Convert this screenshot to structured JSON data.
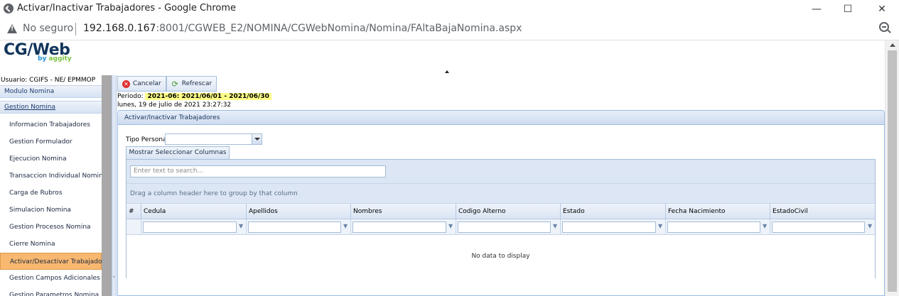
{
  "window": {
    "title": "Activar/Inactivar Trabajadores - Google Chrome",
    "minimize": "—",
    "maximize": "☐",
    "close": "✕"
  },
  "address": {
    "security": "No seguro",
    "url_host": "192.168.0.167",
    "url_path": ":8001/CGWEB_E2/NOMINA/CGWebNomina/Nomina/FAltaBajaNomina.aspx"
  },
  "logo": {
    "text": "CG/Web",
    "by": "by",
    "brand": "aggity"
  },
  "sidebar": {
    "user": "Usuario: CGIFS - NE/ EPMMOP",
    "groups": [
      "Modulo Nomina",
      "Gestion Nomina"
    ],
    "items": [
      "Informacion Trabajadores",
      "Gestion Formulador",
      "Ejecucion Nomina",
      "Transaccion Individual Nomina",
      "Carga de Rubros",
      "Simulacion Nomina",
      "Gestion Procesos Nomina",
      "Cierre Nomina",
      "Activar/Desactivar Trabajadores",
      "Gestion Campos Adicionales",
      "Gestion Parametros Nomina"
    ],
    "active_index": 8
  },
  "toolbar": {
    "cancel": "Cancelar",
    "refresh": "Refrescar"
  },
  "periodo": {
    "label": "Periodo:",
    "value": "2021-06: 2021/06/01 - 2021/06/30"
  },
  "fecha": "lunes, 19 de julio de 2021 23:27:32",
  "panel": {
    "title": "Activar/Inactivar Trabajadores",
    "tipo_label": "Tipo Persona",
    "tipo_value": "",
    "columns_tab": "Mostrar Seleccionar Columnas"
  },
  "grid": {
    "search_placeholder": "Enter text to search...",
    "group_hint": "Drag a column header here to group by that column",
    "columns": [
      "#",
      "Cedula",
      "Apellidos",
      "Nombres",
      "Codigo Alterno",
      "Estado",
      "Fecha Nacimiento",
      "EstadoCivil"
    ],
    "empty": "No data to display"
  },
  "colors": {
    "active_item": "#f8b870",
    "periodo_highlight": "#ffff88",
    "grid_bg": "#dce6f4"
  }
}
